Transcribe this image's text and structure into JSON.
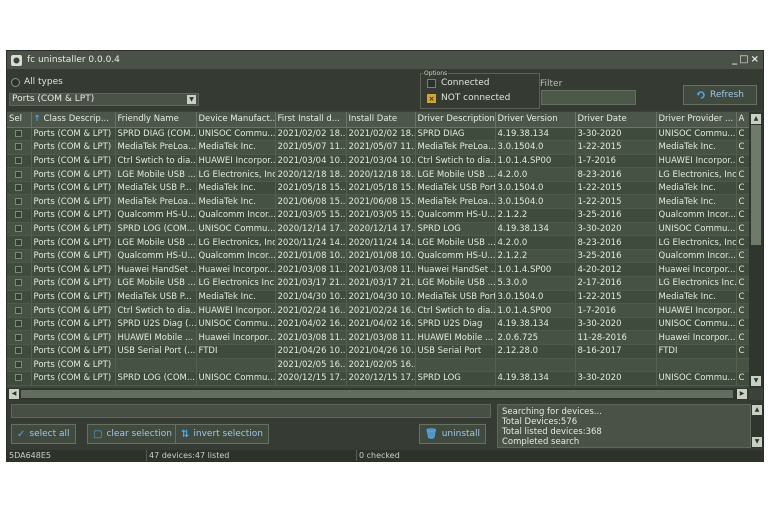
{
  "window": {
    "title": "fc uninstaller 0.0.0.4",
    "controls": [
      "_",
      "□",
      "×"
    ]
  },
  "top": {
    "all_types_label": "All types",
    "class_select_value": "Ports (COM & LPT)",
    "options_legend": "Options",
    "connected_label": "Connected",
    "not_connected_label": "NOT connected",
    "filter_label": "Filter",
    "filter_value": "",
    "refresh_label": "Refresh"
  },
  "table": {
    "columns": [
      "Sel",
      "Class Descrip...",
      "Friendly Name",
      "Device Manufact...",
      "First Install d...",
      "Install Date",
      "Driver Description",
      "Driver Version",
      "Driver Date",
      "Driver Provider ...",
      "A"
    ],
    "rows": [
      [
        "",
        "Ports (COM & LPT)",
        "SPRD DIAG (COM...",
        "UNISOC Commu...",
        "2021/02/02 18...",
        "2021/02/02 18...",
        "SPRD DIAG",
        "4.19.38.134",
        "3-30-2020",
        "UNISOC Commu...",
        "C"
      ],
      [
        "",
        "Ports (COM & LPT)",
        "MediaTek PreLoa...",
        "MediaTek Inc.",
        "2021/05/07 11...",
        "2021/05/07 11...",
        "MediaTek PreLoa...",
        "3.0.1504.0",
        "1-22-2015",
        "MediaTek Inc.",
        "C"
      ],
      [
        "",
        "Ports (COM & LPT)",
        "Ctrl Swtich to dia...",
        "HUAWEI Incorpor...",
        "2021/03/04 10...",
        "2021/03/04 10...",
        "Ctrl Swtich to dia...",
        "1.0.1.4.SP00",
        "1-7-2016",
        "HUAWEI Incorpor...",
        "C"
      ],
      [
        "",
        "Ports (COM & LPT)",
        "LGE Mobile USB ...",
        "LG Electronics, Inc.",
        "2020/12/18 18...",
        "2020/12/18 18...",
        "LGE Mobile USB ...",
        "4.2.0.0",
        "8-23-2016",
        "LG Electronics, Inc.",
        "C"
      ],
      [
        "",
        "Ports (COM & LPT)",
        "MediaTek USB P...",
        "MediaTek Inc.",
        "2021/05/18 15...",
        "2021/05/18 15...",
        "MediaTek USB Port",
        "3.0.1504.0",
        "1-22-2015",
        "MediaTek Inc.",
        "C"
      ],
      [
        "",
        "Ports (COM & LPT)",
        "MediaTek PreLoa...",
        "MediaTek Inc.",
        "2021/06/08 15...",
        "2021/06/08 15...",
        "MediaTek PreLoa...",
        "3.0.1504.0",
        "1-22-2015",
        "MediaTek Inc.",
        "C"
      ],
      [
        "",
        "Ports (COM & LPT)",
        "Qualcomm HS-U...",
        "Qualcomm Incor...",
        "2021/03/05 15...",
        "2021/03/05 15...",
        "Qualcomm HS-U...",
        "2.1.2.2",
        "3-25-2016",
        "Qualcomm Incor...",
        "C"
      ],
      [
        "",
        "Ports (COM & LPT)",
        "SPRD LOG (COM...",
        "UNISOC Commu...",
        "2020/12/14 17...",
        "2020/12/14 17...",
        "SPRD LOG",
        "4.19.38.134",
        "3-30-2020",
        "UNISOC Commu...",
        "C"
      ],
      [
        "",
        "Ports (COM & LPT)",
        "LGE Mobile USB ...",
        "LG Electronics, Inc.",
        "2020/11/24 14...",
        "2020/11/24 14...",
        "LGE Mobile USB ...",
        "4.2.0.0",
        "8-23-2016",
        "LG Electronics, Inc.",
        "C"
      ],
      [
        "",
        "Ports (COM & LPT)",
        "Qualcomm HS-U...",
        "Qualcomm Incor...",
        "2021/01/08 10...",
        "2021/01/08 10...",
        "Qualcomm HS-U...",
        "2.1.2.2",
        "3-25-2016",
        "Qualcomm Incor...",
        "C"
      ],
      [
        "",
        "Ports (COM & LPT)",
        "Huawei HandSet ...",
        "Huawei Incorpor...",
        "2021/03/08 11...",
        "2021/03/08 11...",
        "Huawei HandSet ...",
        "1.0.1.4.SP00",
        "4-20-2012",
        "Huawei Incorpor...",
        "C"
      ],
      [
        "",
        "Ports (COM & LPT)",
        "LGE Mobile USB ...",
        "LG Electronics Inc.",
        "2021/03/17 21...",
        "2021/03/17 21...",
        "LGE Mobile USB ...",
        "5.3.0.0",
        "2-17-2016",
        "LG Electronics Inc.",
        "C"
      ],
      [
        "",
        "Ports (COM & LPT)",
        "MediaTek USB P...",
        "MediaTek Inc.",
        "2021/04/30 10...",
        "2021/04/30 10...",
        "MediaTek USB Port",
        "3.0.1504.0",
        "1-22-2015",
        "MediaTek Inc.",
        "C"
      ],
      [
        "",
        "Ports (COM & LPT)",
        "Ctrl Swtich to dia...",
        "HUAWEI Incorpor...",
        "2021/02/24 16...",
        "2021/02/24 16...",
        "Ctrl Swtich to dia...",
        "1.0.1.4.SP00",
        "1-7-2016",
        "HUAWEI Incorpor...",
        "C"
      ],
      [
        "",
        "Ports (COM & LPT)",
        "SPRD U2S Diag (...",
        "UNISOC Commu...",
        "2021/04/02 16...",
        "2021/04/02 16...",
        "SPRD U2S Diag",
        "4.19.38.134",
        "3-30-2020",
        "UNISOC Commu...",
        "C"
      ],
      [
        "",
        "Ports (COM & LPT)",
        "HUAWEI Mobile ...",
        "Huawei Incorpor...",
        "2021/03/08 11...",
        "2021/03/08 11...",
        "HUAWEI Mobile ...",
        "2.0.6.725",
        "11-28-2016",
        "Huawei Incorpor...",
        "C"
      ],
      [
        "",
        "Ports (COM & LPT)",
        "USB Serial Port (...",
        "FTDI",
        "2021/04/26 10...",
        "2021/04/26 10...",
        "USB Serial Port",
        "2.12.28.0",
        "8-16-2017",
        "FTDI",
        "C"
      ],
      [
        "",
        "Ports (COM & LPT)",
        "",
        "",
        "2021/02/05 16...",
        "2021/02/05 16...",
        "",
        "",
        "",
        "",
        ""
      ],
      [
        "",
        "Ports (COM & LPT)",
        "SPRD LOG (COM...",
        "UNISOC Commu...",
        "2020/12/15 17...",
        "2020/12/15 17...",
        "SPRD LOG",
        "4.19.38.134",
        "3-30-2020",
        "UNISOC Commu...",
        "C"
      ]
    ]
  },
  "actions": {
    "select_all": "select all",
    "clear_selection": "clear selection",
    "invert_selection": "invert selection",
    "uninstall": "uninstall"
  },
  "log": [
    "Searching for devices...",
    "Total Devices:576",
    "Total listed devices:368",
    "Completed search"
  ],
  "status": {
    "id": "5DA648E5",
    "devices": "47 devices:47 listed",
    "checked": "0 checked"
  },
  "colors": {
    "accent": "#9ec6e8",
    "window_bg": "#3b4239",
    "row_a": "#3f4b3c",
    "row_b": "#465244",
    "check_on": "#d6a62a"
  }
}
